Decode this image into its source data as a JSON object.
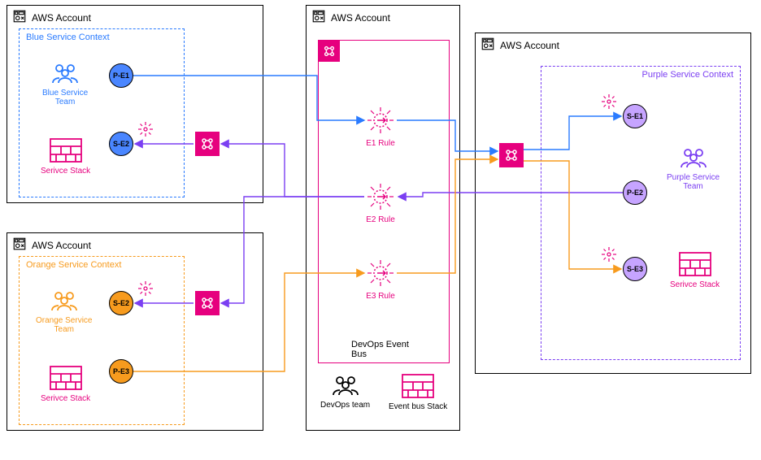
{
  "accounts": {
    "blue": {
      "title": "AWS Account"
    },
    "orange": {
      "title": "AWS Account"
    },
    "center": {
      "title": "AWS Account"
    },
    "purple": {
      "title": "AWS Account"
    }
  },
  "contexts": {
    "blue": {
      "title": "Blue Service Context",
      "color": "#2a7bff"
    },
    "orange": {
      "title": "Orange Service Context",
      "color": "#f79b1e"
    },
    "purple": {
      "title": "Purple Service Context",
      "color": "#7b3ff2"
    }
  },
  "teams": {
    "blue": {
      "label": "Blue Service\nTeam",
      "color": "#2a7bff"
    },
    "orange": {
      "label": "Orange Service\nTeam",
      "color": "#f79b1e"
    },
    "purple": {
      "label": "Purple Service\nTeam",
      "color": "#7b3ff2"
    },
    "devops": {
      "label": "DevOps team",
      "color": "#000000"
    }
  },
  "stacks": {
    "blue": {
      "label": "Serivce Stack"
    },
    "orange": {
      "label": "Serivce Stack"
    },
    "purple": {
      "label": "Serivce Stack"
    },
    "bus": {
      "label": "Event bus Stack"
    }
  },
  "bus": {
    "label": "DevOps Event Bus",
    "rules": {
      "e1": "E1 Rule",
      "e2": "E2 Rule",
      "e3": "E3 Rule"
    }
  },
  "events": {
    "pe1": "P-E1",
    "se2_blue": "S-E2",
    "se2_orange": "S-E2",
    "pe3": "P-E3",
    "se1": "S-E1",
    "pe2": "P-E2",
    "se3": "S-E3"
  },
  "colors": {
    "pink": "#e6007e",
    "blue": "#2a7bff",
    "orange": "#f79b1e",
    "purple": "#7b3ff2"
  }
}
